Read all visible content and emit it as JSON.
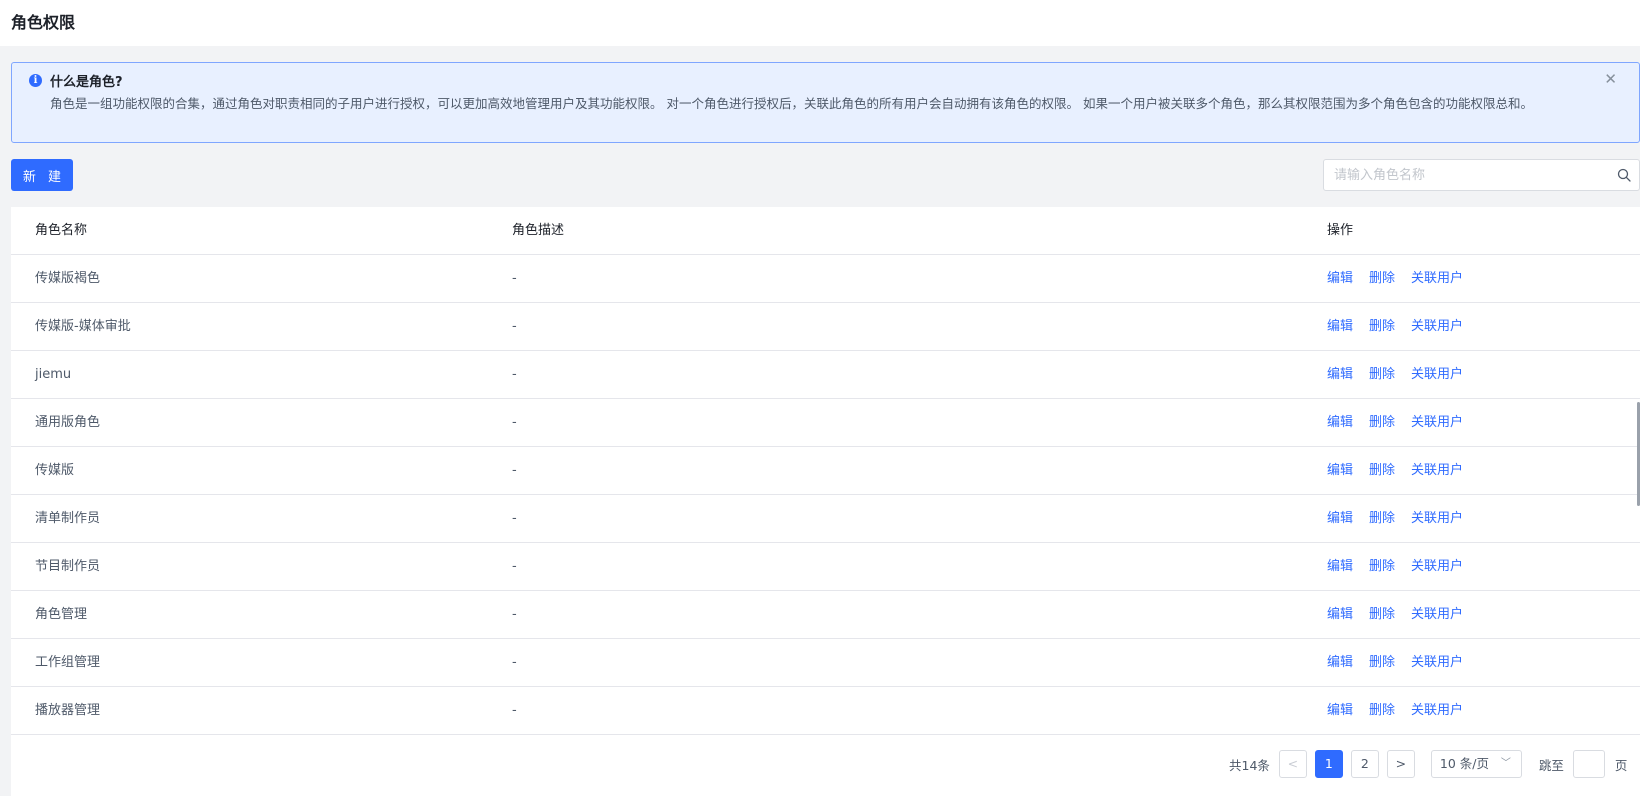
{
  "header": {
    "title": "角色权限"
  },
  "alert": {
    "title": "什么是角色?",
    "text": "角色是一组功能权限的合集，通过角色对职责相同的子用户进行授权，可以更加高效地管理用户及其功能权限。 对一个角色进行授权后，关联此角色的所有用户会自动拥有该角色的权限。 如果一个用户被关联多个角色，那么其权限范围为多个角色包含的功能权限总和。",
    "icon": "info-icon",
    "close_glyph": "✕"
  },
  "toolbar": {
    "new_label": "新 建",
    "search_placeholder": "请输入角色名称"
  },
  "table": {
    "headers": {
      "name": "角色名称",
      "description": "角色描述",
      "actions": "操作"
    },
    "action_labels": {
      "edit": "编辑",
      "delete": "删除",
      "link_users": "关联用户"
    },
    "rows": [
      {
        "name": "传媒版褐色",
        "description": "-"
      },
      {
        "name": "传媒版-媒体审批",
        "description": "-"
      },
      {
        "name": "jiemu",
        "description": "-"
      },
      {
        "name": "通用版角色",
        "description": "-"
      },
      {
        "name": "传媒版",
        "description": "-"
      },
      {
        "name": "清单制作员",
        "description": "-"
      },
      {
        "name": "节目制作员",
        "description": "-"
      },
      {
        "name": "角色管理",
        "description": "-"
      },
      {
        "name": "工作组管理",
        "description": "-"
      },
      {
        "name": "播放器管理",
        "description": "-"
      }
    ]
  },
  "pagination": {
    "total_label": "共14条",
    "prev_glyph": "<",
    "next_glyph": ">",
    "pages": [
      "1",
      "2"
    ],
    "current_page": "1",
    "page_size_label": "10 条/页",
    "jump_label": "跳至",
    "jump_unit": "页"
  },
  "colors": {
    "primary": "#2f6bff",
    "alert_bg": "#e8f0ff",
    "alert_border": "#7fa6ff"
  }
}
